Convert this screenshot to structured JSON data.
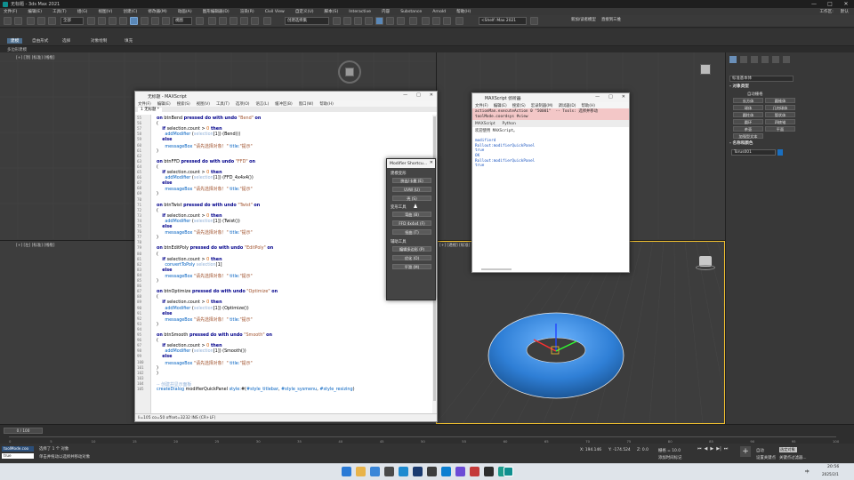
{
  "app": {
    "title": "无标题 - 3ds Max 2021"
  },
  "menubar": {
    "items": [
      "文件(F)",
      "编辑(E)",
      "工具(T)",
      "组(G)",
      "视图(V)",
      "创建(C)",
      "修改器(M)",
      "动画(A)",
      "图形编辑器(D)",
      "渲染(R)",
      "Civil View",
      "自定义(U)",
      "脚本(S)",
      "Interactive",
      "内容",
      "Substance",
      "Arnold",
      "帮助(H)"
    ],
    "right": [
      "工作区:",
      "默认"
    ]
  },
  "toolbar": {
    "selection_filter": "全部",
    "view_mode": "视图",
    "selset": "创建选择集",
    "workspace_field": "<Shelf:  Max 2021",
    "open_file": "新加/读者模型",
    "external": "直接到三维"
  },
  "ribbon": {
    "tabs": [
      "建模",
      "自由形式",
      "选择",
      "对象绘制",
      "填充"
    ],
    "active": 0,
    "sub": "多边形建模"
  },
  "viewports": {
    "top_left": "[+] [顶] [标准] [线框]",
    "bottom_left": "[+] [左] [标准] [线框]",
    "perspective": "[+] [透视] [标准] [默认明暗处理]"
  },
  "cmdpanel": {
    "category": "标准基本体",
    "object_type_label": "- 对象类型",
    "autogrid": "自动栅格",
    "buttons": [
      "长方体",
      "圆锥体",
      "球体",
      "几何球体",
      "圆柱体",
      "管状体",
      "圆环",
      "四棱锥",
      "茶壶",
      "平面",
      "加强型文本"
    ],
    "name_color_label": "- 名称和颜色",
    "object_name": "Torus001",
    "object_color": "#1a6fc0"
  },
  "editor": {
    "title": "无标题 - MAXScript",
    "menu": [
      "文件(F)",
      "编辑(E)",
      "搜索(S)",
      "视图(V)",
      "工具(T)",
      "选项(O)",
      "语言(L)",
      "缓冲区(B)",
      "窗口(W)",
      "帮助(H)"
    ],
    "tab": "1 无标题 *",
    "status": "li=105 co=50 offset=3232 INS (CR+LF)",
    "code": [
      {
        "n": "55",
        "t": [
          {
            "c": "kw",
            "v": "on"
          },
          {
            "c": "",
            "v": " btnBend "
          },
          {
            "c": "kw",
            "v": "pressed do with undo"
          },
          {
            "c": "st",
            "v": " \"Bend\" "
          },
          {
            "c": "kw",
            "v": "on"
          }
        ]
      },
      {
        "n": "56",
        "t": [
          {
            "c": "",
            "v": "("
          }
        ]
      },
      {
        "n": "57",
        "t": [
          {
            "c": "",
            "v": "    "
          },
          {
            "c": "kw",
            "v": "if"
          },
          {
            "c": "",
            "v": " selection.count "
          },
          {
            "c": "",
            "v": "> "
          },
          {
            "c": "nm",
            "v": "0"
          },
          {
            "c": "kw",
            "v": " then"
          }
        ]
      },
      {
        "n": "58",
        "t": [
          {
            "c": "",
            "v": "      "
          },
          {
            "c": "fn",
            "v": "addModifier"
          },
          {
            "c": "",
            "v": " ("
          },
          {
            "c": "gr",
            "v": "selection"
          },
          {
            "c": "",
            "v": "[1]) (Bend())"
          }
        ]
      },
      {
        "n": "59",
        "t": [
          {
            "c": "",
            "v": "    "
          },
          {
            "c": "kw",
            "v": "else"
          }
        ]
      },
      {
        "n": "60",
        "t": [
          {
            "c": "",
            "v": "      "
          },
          {
            "c": "fn",
            "v": "messageBox"
          },
          {
            "c": "st",
            "v": " \"请先选择对象！\""
          },
          {
            "c": "fn",
            "v": " title:"
          },
          {
            "c": "st",
            "v": "\"提示\""
          }
        ]
      },
      {
        "n": "61",
        "t": [
          {
            "c": "",
            "v": ")"
          }
        ]
      },
      {
        "n": "62",
        "t": [
          {
            "c": "",
            "v": ""
          }
        ]
      },
      {
        "n": "63",
        "t": [
          {
            "c": "kw",
            "v": "on"
          },
          {
            "c": "",
            "v": " btnFFD "
          },
          {
            "c": "kw",
            "v": "pressed do with undo"
          },
          {
            "c": "st",
            "v": " \"FFD\" "
          },
          {
            "c": "kw",
            "v": "on"
          }
        ]
      },
      {
        "n": "64",
        "t": [
          {
            "c": "",
            "v": "("
          }
        ]
      },
      {
        "n": "65",
        "t": [
          {
            "c": "",
            "v": "    "
          },
          {
            "c": "kw",
            "v": "if"
          },
          {
            "c": "",
            "v": " selection.count "
          },
          {
            "c": "",
            "v": "> "
          },
          {
            "c": "nm",
            "v": "0"
          },
          {
            "c": "kw",
            "v": " then"
          }
        ]
      },
      {
        "n": "66",
        "t": [
          {
            "c": "",
            "v": "      "
          },
          {
            "c": "fn",
            "v": "addModifier"
          },
          {
            "c": "",
            "v": " ("
          },
          {
            "c": "gr",
            "v": "selection"
          },
          {
            "c": "",
            "v": "[1]) (FFD_4x4x4())"
          }
        ]
      },
      {
        "n": "67",
        "t": [
          {
            "c": "",
            "v": "    "
          },
          {
            "c": "kw",
            "v": "else"
          }
        ]
      },
      {
        "n": "68",
        "t": [
          {
            "c": "",
            "v": "      "
          },
          {
            "c": "fn",
            "v": "messageBox"
          },
          {
            "c": "st",
            "v": " \"请先选择对象！\""
          },
          {
            "c": "fn",
            "v": " title:"
          },
          {
            "c": "st",
            "v": "\"提示\""
          }
        ]
      },
      {
        "n": "69",
        "t": [
          {
            "c": "",
            "v": ")"
          }
        ]
      },
      {
        "n": "70",
        "t": [
          {
            "c": "",
            "v": ""
          }
        ]
      },
      {
        "n": "71",
        "t": [
          {
            "c": "kw",
            "v": "on"
          },
          {
            "c": "",
            "v": " btnTwist "
          },
          {
            "c": "kw",
            "v": "pressed do with undo"
          },
          {
            "c": "st",
            "v": " \"Twist\" "
          },
          {
            "c": "kw",
            "v": "on"
          }
        ]
      },
      {
        "n": "72",
        "t": [
          {
            "c": "",
            "v": "("
          }
        ]
      },
      {
        "n": "73",
        "t": [
          {
            "c": "",
            "v": "    "
          },
          {
            "c": "kw",
            "v": "if"
          },
          {
            "c": "",
            "v": " selection.count "
          },
          {
            "c": "",
            "v": "> "
          },
          {
            "c": "nm",
            "v": "0"
          },
          {
            "c": "kw",
            "v": " then"
          }
        ]
      },
      {
        "n": "74",
        "t": [
          {
            "c": "",
            "v": "      "
          },
          {
            "c": "fn",
            "v": "addModifier"
          },
          {
            "c": "",
            "v": " ("
          },
          {
            "c": "gr",
            "v": "selection"
          },
          {
            "c": "",
            "v": "[1]) (Twist())"
          }
        ]
      },
      {
        "n": "75",
        "t": [
          {
            "c": "",
            "v": "    "
          },
          {
            "c": "kw",
            "v": "else"
          }
        ]
      },
      {
        "n": "76",
        "t": [
          {
            "c": "",
            "v": "      "
          },
          {
            "c": "fn",
            "v": "messageBox"
          },
          {
            "c": "st",
            "v": " \"请先选择对象！\""
          },
          {
            "c": "fn",
            "v": " title:"
          },
          {
            "c": "st",
            "v": "\"提示\""
          }
        ]
      },
      {
        "n": "77",
        "t": [
          {
            "c": "",
            "v": ")"
          }
        ]
      },
      {
        "n": "78",
        "t": [
          {
            "c": "",
            "v": ""
          }
        ]
      },
      {
        "n": "79",
        "t": [
          {
            "c": "kw",
            "v": "on"
          },
          {
            "c": "",
            "v": " btnEditPoly "
          },
          {
            "c": "kw",
            "v": "pressed do with undo"
          },
          {
            "c": "st",
            "v": " \"EditPoly\" "
          },
          {
            "c": "kw",
            "v": "on"
          }
        ]
      },
      {
        "n": "80",
        "t": [
          {
            "c": "",
            "v": "("
          }
        ]
      },
      {
        "n": "81",
        "t": [
          {
            "c": "",
            "v": "    "
          },
          {
            "c": "kw",
            "v": "if"
          },
          {
            "c": "",
            "v": " selection.count "
          },
          {
            "c": "",
            "v": "> "
          },
          {
            "c": "nm",
            "v": "0"
          },
          {
            "c": "kw",
            "v": " then"
          }
        ]
      },
      {
        "n": "82",
        "t": [
          {
            "c": "",
            "v": "      "
          },
          {
            "c": "fn",
            "v": "convertToPoly"
          },
          {
            "c": "",
            "v": " "
          },
          {
            "c": "gr",
            "v": "selection"
          },
          {
            "c": "",
            "v": "[1]"
          }
        ]
      },
      {
        "n": "83",
        "t": [
          {
            "c": "",
            "v": "    "
          },
          {
            "c": "kw",
            "v": "else"
          }
        ]
      },
      {
        "n": "84",
        "t": [
          {
            "c": "",
            "v": "      "
          },
          {
            "c": "fn",
            "v": "messageBox"
          },
          {
            "c": "st",
            "v": " \"请先选择对象！\""
          },
          {
            "c": "fn",
            "v": " title:"
          },
          {
            "c": "st",
            "v": "\"提示\""
          }
        ]
      },
      {
        "n": "85",
        "t": [
          {
            "c": "",
            "v": ")"
          }
        ]
      },
      {
        "n": "86",
        "t": [
          {
            "c": "",
            "v": ""
          }
        ]
      },
      {
        "n": "87",
        "t": [
          {
            "c": "kw",
            "v": "on"
          },
          {
            "c": "",
            "v": " btnOptimize "
          },
          {
            "c": "kw",
            "v": "pressed do with undo"
          },
          {
            "c": "st",
            "v": " \"Optimize\" "
          },
          {
            "c": "kw",
            "v": "on"
          }
        ]
      },
      {
        "n": "88",
        "t": [
          {
            "c": "",
            "v": "("
          }
        ]
      },
      {
        "n": "89",
        "t": [
          {
            "c": "",
            "v": "    "
          },
          {
            "c": "kw",
            "v": "if"
          },
          {
            "c": "",
            "v": " selection.count "
          },
          {
            "c": "",
            "v": "> "
          },
          {
            "c": "nm",
            "v": "0"
          },
          {
            "c": "kw",
            "v": " then"
          }
        ]
      },
      {
        "n": "90",
        "t": [
          {
            "c": "",
            "v": "      "
          },
          {
            "c": "fn",
            "v": "addModifier"
          },
          {
            "c": "",
            "v": " ("
          },
          {
            "c": "gr",
            "v": "selection"
          },
          {
            "c": "",
            "v": "[1]) (Optimize())"
          }
        ]
      },
      {
        "n": "91",
        "t": [
          {
            "c": "",
            "v": "    "
          },
          {
            "c": "kw",
            "v": "else"
          }
        ]
      },
      {
        "n": "92",
        "t": [
          {
            "c": "",
            "v": "      "
          },
          {
            "c": "fn",
            "v": "messageBox"
          },
          {
            "c": "st",
            "v": " \"请先选择对象！\""
          },
          {
            "c": "fn",
            "v": " title:"
          },
          {
            "c": "st",
            "v": "\"提示\""
          }
        ]
      },
      {
        "n": "93",
        "t": [
          {
            "c": "",
            "v": ")"
          }
        ]
      },
      {
        "n": "94",
        "t": [
          {
            "c": "",
            "v": ""
          }
        ]
      },
      {
        "n": "95",
        "t": [
          {
            "c": "kw",
            "v": "on"
          },
          {
            "c": "",
            "v": " btnSmooth "
          },
          {
            "c": "kw",
            "v": "pressed do with undo"
          },
          {
            "c": "st",
            "v": " \"Smooth\" "
          },
          {
            "c": "kw",
            "v": "on"
          }
        ]
      },
      {
        "n": "96",
        "t": [
          {
            "c": "",
            "v": "("
          }
        ]
      },
      {
        "n": "97",
        "t": [
          {
            "c": "",
            "v": "    "
          },
          {
            "c": "kw",
            "v": "if"
          },
          {
            "c": "",
            "v": " selection.count "
          },
          {
            "c": "",
            "v": "> "
          },
          {
            "c": "nm",
            "v": "0"
          },
          {
            "c": "kw",
            "v": " then"
          }
        ]
      },
      {
        "n": "98",
        "t": [
          {
            "c": "",
            "v": "      "
          },
          {
            "c": "fn",
            "v": "addModifier"
          },
          {
            "c": "",
            "v": " ("
          },
          {
            "c": "gr",
            "v": "selection"
          },
          {
            "c": "",
            "v": "[1]) (Smooth())"
          }
        ]
      },
      {
        "n": "99",
        "t": [
          {
            "c": "",
            "v": "    "
          },
          {
            "c": "kw",
            "v": "else"
          }
        ]
      },
      {
        "n": "100",
        "t": [
          {
            "c": "",
            "v": "      "
          },
          {
            "c": "fn",
            "v": "messageBox"
          },
          {
            "c": "st",
            "v": " \"请先选择对象！\""
          },
          {
            "c": "fn",
            "v": " title:"
          },
          {
            "c": "st",
            "v": "\"提示\""
          }
        ]
      },
      {
        "n": "101",
        "t": [
          {
            "c": "",
            "v": ")"
          }
        ]
      },
      {
        "n": "102",
        "t": [
          {
            "c": "",
            "v": ")"
          }
        ]
      },
      {
        "n": "103",
        "t": [
          {
            "c": "",
            "v": ""
          }
        ]
      },
      {
        "n": "104",
        "t": [
          {
            "c": "gr",
            "v": "-- 创建并显示面板"
          }
        ]
      },
      {
        "n": "105",
        "t": [
          {
            "c": "fn",
            "v": "createDialog"
          },
          {
            "c": "",
            "v": " modifierQuickPanel "
          },
          {
            "c": "fn",
            "v": "style:"
          },
          {
            "c": "",
            "v": "#("
          },
          {
            "c": "fn",
            "v": "#style_titlebar"
          },
          {
            "c": "",
            "v": ", "
          },
          {
            "c": "fn",
            "v": "#style_sysmenu"
          },
          {
            "c": "",
            "v": ", "
          },
          {
            "c": "fn",
            "v": "#style_resizing"
          },
          {
            "c": "",
            "v": ")"
          }
        ]
      }
    ]
  },
  "listener": {
    "title": "MAXScript 侦听器",
    "menu": [
      "文件(F)",
      "编辑(E)",
      "搜索(S)",
      "宏录制器(M)",
      "调试器(D)",
      "帮助(H)"
    ],
    "macro": [
      "actionMan.executeAction 0 \"50001\"  -- Tools: 选择并移动",
      "toolMode.coordsys #view"
    ],
    "tabs": [
      "MAXScript",
      "Python"
    ],
    "output": [
      {
        "c": "#222",
        "v": "欢迎使用 MAXScript。"
      },
      {
        "c": "#222",
        "v": ""
      },
      {
        "c": "#1a55c0",
        "v": "modifierd"
      },
      {
        "c": "#1a55c0",
        "v": "Rollout:modifierQuickPanel"
      },
      {
        "c": "#1a55c0",
        "v": "true"
      },
      {
        "c": "#1a55c0",
        "v": "OK"
      },
      {
        "c": "#1a55c0",
        "v": "Rollout:modifierQuickPanel"
      },
      {
        "c": "#1a55c0",
        "v": "true"
      }
    ]
  },
  "rollout": {
    "title": "Modifier Shortcu...",
    "groups": [
      "建模变形",
      "变形工具",
      "辅助工具"
    ],
    "buttons": [
      "挤出/卡曼 (E)",
      "UVW (U)",
      "壳 (S)",
      "弯曲 (B)",
      "FFD 4x4x4 (F)",
      "扭曲 (T)",
      "编辑多边形 (P)",
      "优化 (O)",
      "平滑 (M)"
    ]
  },
  "timeline": {
    "frame": "0 / 100",
    "ticks": [
      "0",
      "5",
      "10",
      "15",
      "20",
      "25",
      "30",
      "35",
      "40",
      "45",
      "50",
      "55",
      "60",
      "65",
      "70",
      "75",
      "80",
      "85",
      "90",
      "95",
      "100"
    ]
  },
  "status": {
    "script_mode": "toolMode.coo",
    "script_value": "true",
    "line1": "选择了 1 个 对象",
    "line2": "单击并拖动以选择并移动对象",
    "x": "X: 194.146",
    "y": "Y: -174.524",
    "z": "Z: 0.0",
    "grid": "栅格 = 10.0",
    "addtime": "添加时间标记",
    "autokey": "自动",
    "setkey": "设置关键点",
    "selected": "选定对象",
    "keyfilter": "关键点过滤器..."
  },
  "taskbar": {
    "time": "20:56",
    "date": "2025/2/1",
    "lang": "中"
  },
  "colors": {
    "accent": "#4d6f8f",
    "torus": "#2f7fd6",
    "selection": "#f0c030"
  }
}
